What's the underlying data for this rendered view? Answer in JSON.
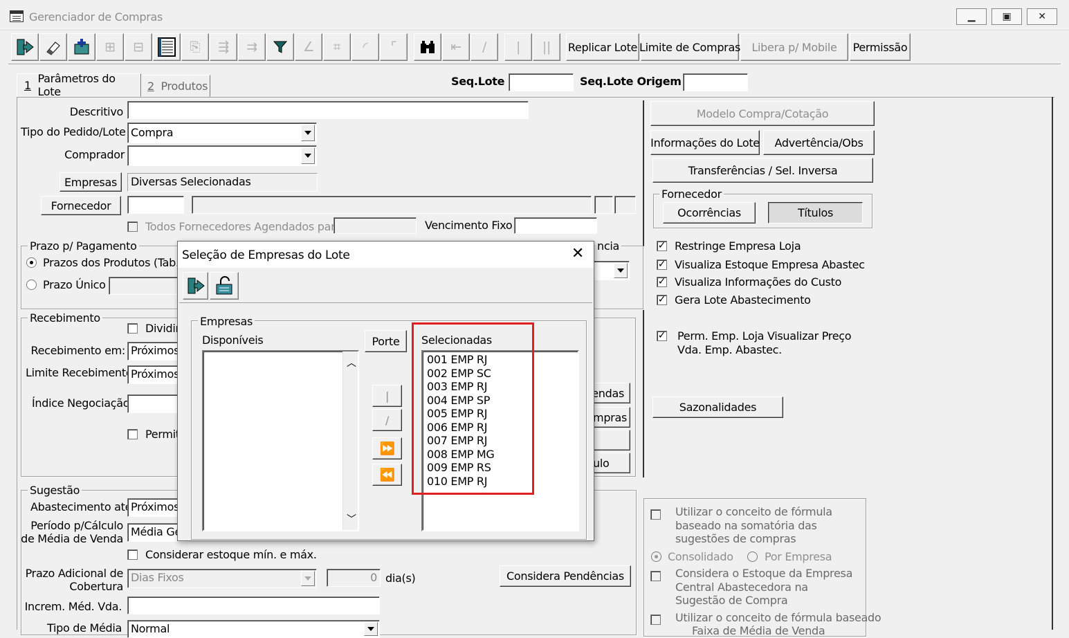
{
  "window": {
    "title": "Gerenciador de Compras",
    "controls": [
      "▭",
      "▣",
      "✕"
    ]
  },
  "toolbar": {
    "replicar_lote": "Replicar Lote",
    "limite_compras": "Limite de Compras",
    "libera_mobile": "Libera p/ Mobile",
    "permissao": "Permissão"
  },
  "tabs": [
    {
      "num": "1",
      "label": "Parâmetros do Lote"
    },
    {
      "num": "2",
      "label": "Produtos"
    }
  ],
  "header_fields": {
    "seq_lote_label": "Seq.Lote",
    "seq_lote_origem_label": "Seq.Lote Origem"
  },
  "form": {
    "descritivo_label": "Descritivo",
    "tipo_pedido_label": "Tipo do Pedido/Lote",
    "tipo_pedido_value": "Compra",
    "comprador_label": "Comprador",
    "empresas_button": "Empresas",
    "empresas_value": "Diversas Selecionadas",
    "fornecedor_button": "Fornecedor",
    "todos_fornecedores_label": "Todos Fornecedores Agendados para",
    "vencimento_fixo_label": "Vencimento Fixo",
    "prazo_group": "Prazo p/ Pagamento",
    "prazo_produtos": "Prazos dos Produtos (Tab.",
    "prazo_unico": "Prazo Único",
    "hidden_group_fragment": "ncia",
    "recebimento_group": "Recebimento",
    "dividir": "Dividir",
    "recebimento_em_label": "Recebimento em:",
    "recebimento_em_value": "Próximos",
    "limite_recebimento_label": "Limite Recebimento:",
    "limite_recebimento_value": "Próximos",
    "indice_negociacao_label": "Índice Negociação",
    "permite": "Permite",
    "btn_fragment_1": "endas",
    "btn_fragment_2": "mpras",
    "btn_fragment_3": "ulo",
    "sugestao_group": "Sugestão",
    "abastecimento_label": "Abastecimento até",
    "abastecimento_value": "Próximos",
    "periodo_label_1": "Período p/Cálculo",
    "periodo_label_2": "de Média de Venda",
    "periodo_value": "Média Ge",
    "considerar_estoque": "Considerar estoque mín. e máx.",
    "prazo_adicional_1": "Prazo Adicional de",
    "prazo_adicional_2": "Cobertura",
    "prazo_adicional_value": "Dias Fixos",
    "prazo_adicional_num": "0",
    "dias_label": "dia(s)",
    "considera_pendencias": "Considera Pendências",
    "increm_label": "Increm. Méd. Vda.",
    "tipo_media_label": "Tipo de Média",
    "tipo_media_value": "Normal"
  },
  "right_panel": {
    "modelo_compra": "Modelo Compra/Cotação",
    "informacoes_lote": "Informações do Lote",
    "advertencia": "Advertência/Obs",
    "transferencias": "Transferências / Sel. Inversa",
    "fornecedor_group": "Fornecedor",
    "ocorrencias": "Ocorrências",
    "titulos": "Títulos",
    "restringe": "Restringe Empresa Loja",
    "visualiza_estoque": "Visualiza Estoque Empresa Abastec",
    "visualiza_info": "Visualiza Informações do Custo",
    "gera_lote": "Gera Lote Abastecimento",
    "perm_emp_1": "Perm. Emp. Loja Visualizar Preço",
    "perm_emp_2": "Vda. Emp. Abastec.",
    "sazonalidades": "Sazonalidades",
    "utilizar_1": "Utilizar o conceito de fórmula",
    "utilizar_2": "baseado na somatória das",
    "utilizar_3": "sugestões de compras",
    "consolidado": "Consolidado",
    "por_empresa": "Por Empresa",
    "considera_1": "Considera o Estoque da Empresa",
    "considera_2": "Central Abastecedora na",
    "considera_3": "Sugestão de Compra",
    "utilizar_b_1": "Utilizar o conceito de fórmula baseado",
    "utilizar_b_2": "Faixa de Média de Venda"
  },
  "dialog": {
    "title": "Seleção de Empresas do Lote",
    "close": "✕",
    "empresas_group": "Empresas",
    "disponiveis_label": "Disponíveis",
    "porte_button": "Porte",
    "selecionadas_label": "Selecionadas",
    "selecionadas": [
      "001 EMP RJ",
      "002 EMP SC",
      "003 EMP RJ",
      "004 EMP SP",
      "005 EMP RJ",
      "006 EMP RJ",
      "007 EMP RJ",
      "008 EMP MG",
      "009 EMP RS",
      "010 EMP RJ"
    ]
  },
  "colors": {
    "highlight": "#e0201f",
    "window_bg": "#f0f0f0"
  }
}
